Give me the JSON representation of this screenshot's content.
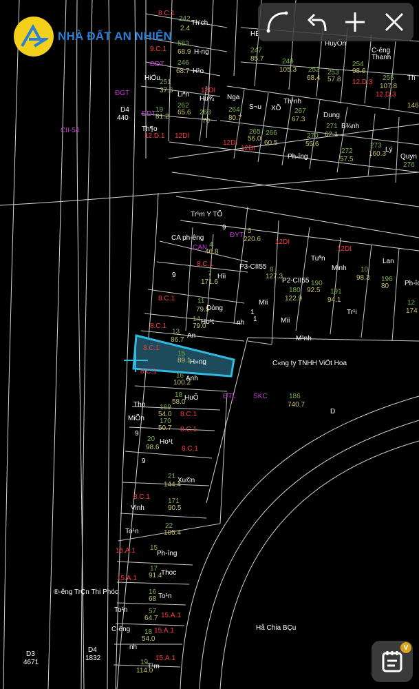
{
  "brand": {
    "name": "NHÀ ĐẤT AN NHIÊN"
  },
  "toolbar": {
    "items": [
      {
        "icon": "curve-draw-icon"
      },
      {
        "icon": "undo-icon"
      },
      {
        "icon": "plus-icon"
      },
      {
        "icon": "close-icon"
      }
    ]
  },
  "fab": {
    "icon": "notepad-icon",
    "badge": "V"
  },
  "map": {
    "labels": {
      "l1": "8.C.1",
      "l2": "242",
      "l3": "Th'ch",
      "l4": "2.4",
      "l5": "9.C.1",
      "l6": "583",
      "l7": "68.9",
      "l8": "H-ng",
      "l9": "ĐDT",
      "l10": "246",
      "l11": "68.7",
      "l12": "H¹o",
      "l13": "HiÖu",
      "l14": "251",
      "l15": "37.6",
      "l16": "Liªn",
      "l17": "262",
      "l18": "65.6",
      "l19": "Hu¾",
      "l20": "12DI",
      "l21": "263",
      "l22": "70",
      "l23": "ĐGT",
      "l24": "D4",
      "l25": "440",
      "l26": "19",
      "l27": "81.2",
      "l28": "ĐDT",
      "l29": "Th¶o",
      "l30": "12.D.1",
      "l31": "12DI",
      "l32": "CII-54",
      "l33": "HÊ",
      "l34": "247",
      "l35": "85.7",
      "l36": "248",
      "l37": "105.3",
      "l38": "252",
      "l39": "68.4",
      "l40": "253",
      "l41": "57.8",
      "l42": "HuyÒn",
      "l43": "C-êng",
      "l44": "Thanh",
      "l45": "254",
      "l46": "98.6",
      "l47": "255",
      "l48": "107.8",
      "l49": "12.D.3",
      "l50": "Nga",
      "l51": "264",
      "l52": "80.7",
      "l53": "S¬u",
      "l54": "XÕ",
      "l55": "Th¹nh",
      "l56": "267",
      "l57": "67.3",
      "l58": "265",
      "l59": "56.0",
      "l60": "266",
      "l61": "60.5",
      "l62": "Dung",
      "l63": "271",
      "l64": "62.1",
      "l65": "B¾nh",
      "l66": "270",
      "l67": "55.6",
      "l68": "272",
      "l69": "57.5",
      "l70": "273",
      "l71": "160.3",
      "l72": "Lý",
      "l73": "Ph-îng",
      "l74": "Quyn",
      "l75": "276",
      "l76": "Tr¹m Y TÕ",
      "l77": "9",
      "l78": "ĐYT",
      "l79": "5",
      "l80": "220.6",
      "l81": "CA ph-êng",
      "l82": "CAN",
      "l83": "4",
      "l84": "46.8",
      "l85": "9",
      "l86": "8.C.1",
      "l87": "7",
      "l88": "171.6",
      "l89": "Hîi",
      "l90": "P3-CII55",
      "l91": "8",
      "l92": "127.3",
      "l93": "12DI",
      "l94": "Tuªn",
      "l95": "Minh",
      "l96": "10",
      "l97": "98.3",
      "l98": "Lan",
      "l99": "196",
      "l100": "80",
      "l101": "12DI",
      "l102": "P2-CII55",
      "l103": "180",
      "l104": "122.9",
      "l105": "190",
      "l106": "92.5",
      "l107": "191",
      "l108": "94.1",
      "l109": "Ph-îc",
      "l110": "12",
      "l111": "174",
      "l112": "Tr¹i",
      "l113": "8.C.1",
      "l114": "11",
      "l115": "79.5",
      "l116": "Dòng",
      "l117": "14",
      "l118": "79.0",
      "l119": "Ho¹t",
      "l120": "Mïi",
      "l121": "Mïi",
      "l122": "8.C.1",
      "l123": "13",
      "l124": "86.7",
      "l125": "An",
      "l126": "M¹nh",
      "l127": "8.C.1",
      "l128": "15",
      "l129": "89.1",
      "l130": "H»ng",
      "l131": "C«ng ty TNHH ViÖt Hoa",
      "l132": "8.C.1",
      "l133": "16",
      "l134": "100.2",
      "l135": "Anh",
      "l136": "ĐTL",
      "l137": "SKC",
      "l138": "186",
      "l139": "740.7",
      "l140": "18",
      "l141": "58.0",
      "l142": "HuÕ",
      "l143": "Tho",
      "l144": "169",
      "l145": "54.0",
      "l146": "8.C.1",
      "l147": "MiÕn",
      "l148": "170",
      "l149": "50.7",
      "l150": "8.C.1",
      "l151": "9",
      "l152": "20",
      "l153": "98.6",
      "l154": "Ho¹t",
      "l155": "8.C.1",
      "l156": "9",
      "l157": "21",
      "l158": "144.4",
      "l159": "Xu©n",
      "l160": "8.C.1",
      "l161": "171",
      "l162": "90.5",
      "l163": "Vinh",
      "l164": "22",
      "l165": "105.4",
      "l166": "To¹n",
      "l167": "15.A.1",
      "l168": "15",
      "l169": "Ph-îng",
      "l170": "17",
      "l171": "91.4",
      "l172": "Thoc",
      "l173": "15.A.1",
      "l174": "16",
      "l175": "68",
      "l176": "To¹n",
      "l177": "®-êng TrÇn Thi Phóc",
      "l178": "To¹n",
      "l179": "57",
      "l180": "64.7",
      "l181": "15.A.1",
      "l182": "C-êng",
      "l183": "18",
      "l184": "54.0",
      "l185": "15.A.1",
      "l186": "nh",
      "l187": "D3",
      "l188": "4671",
      "l189": "D4",
      "l190": "1832",
      "l191": "19",
      "l192": "114.0",
      "l193": "T¹m",
      "l194": "15.A.1",
      "l195": "Hå Chia BÇu",
      "l196": "D",
      "l197": "nh",
      "l198": "1",
      "l199": "1",
      "l200": "12DI",
      "l201": "12DI",
      "l202": "146",
      "l203": "12.D.3",
      "l204": "Th"
    }
  }
}
